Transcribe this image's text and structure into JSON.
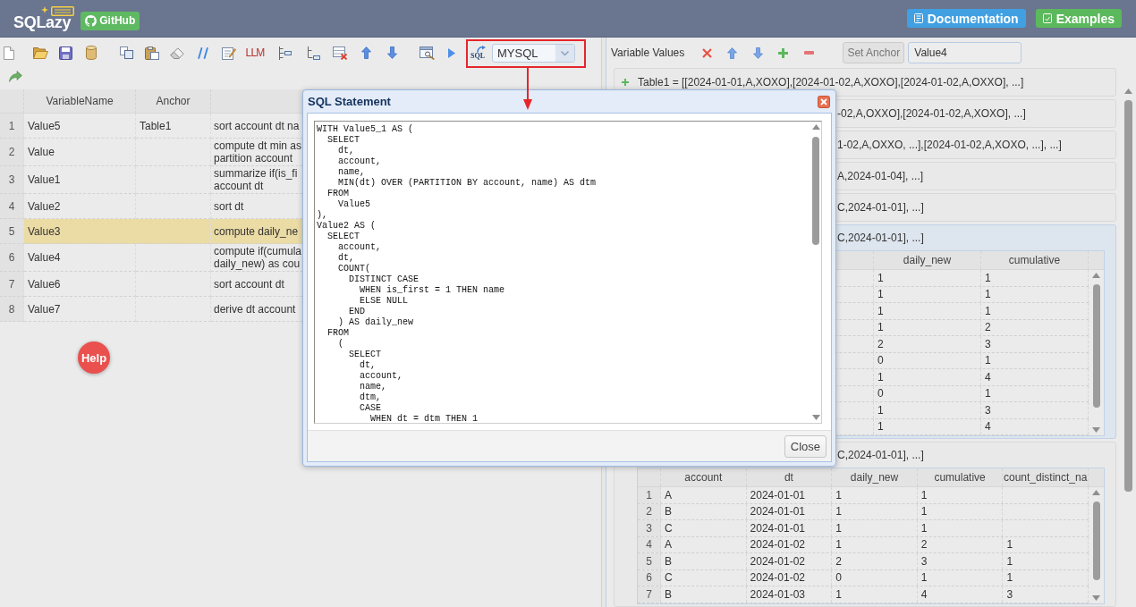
{
  "header": {
    "logo": "SQLazy",
    "badge": "GitHub",
    "links": [
      {
        "kind": "documentation",
        "label": "Documentation",
        "color": "#41a0e2"
      },
      {
        "kind": "examples",
        "label": "Examples",
        "color": "#5cb85c"
      }
    ]
  },
  "toolbar": {
    "llm_button": "LLM",
    "sql_button": "SQL",
    "dialect_select": {
      "value": "MYSQL"
    }
  },
  "variables_table": {
    "columns": [
      "VariableName",
      "Anchor"
    ],
    "rows": [
      {
        "number": "1",
        "name": "Value5",
        "anchor": "Table1",
        "column_3": "sort account dt na",
        "selected": false
      },
      {
        "number": "2",
        "name": "Value",
        "column_3": "compute dt min as\npartition account",
        "selected": false
      },
      {
        "number": "3",
        "name": "Value1",
        "column_3": "summarize if(is_fi\naccount dt",
        "selected": false
      },
      {
        "number": "4",
        "name": "Value2",
        "column_3": "sort dt",
        "selected": false
      },
      {
        "number": "5",
        "name": "Value3",
        "column_3": "compute daily_ne",
        "selected": true
      },
      {
        "number": "6",
        "name": "Value4",
        "column_3": "compute if(cumula\ndaily_new) as cou",
        "selected": false
      },
      {
        "number": "7",
        "name": "Value6",
        "column_3": "sort account dt",
        "selected": false
      },
      {
        "number": "8",
        "name": "Value7",
        "column_3": "derive dt account",
        "selected": false
      }
    ]
  },
  "help_button": "Help",
  "variable_values": {
    "title": "Variable Values",
    "set_anchor_button": "Set Anchor",
    "anchor_field": {
      "value": "Value4"
    },
    "items": [
      {
        "text": "Table1 = [[2024-01-01,A,XOXO],[2024-01-02,A,XOXO],[2024-01-02,A,OXXO], ...]",
        "expanded": false,
        "selected": false
      },
      {
        "text": "-02,A,OXXO],[2024-01-02,A,XOXO], ...]",
        "expanded": false,
        "selected": false
      },
      {
        "text": "1-02,A,OXXO, ...],[2024-01-02,A,XOXO, ...], ...]",
        "expanded": false,
        "selected": false
      },
      {
        "text": "A,2024-01-04], ...]",
        "expanded": false,
        "selected": false
      },
      {
        "text": "C,2024-01-01], ...]",
        "expanded": false,
        "selected": false
      },
      {
        "text": "C,2024-01-01], ...]",
        "expanded": true,
        "selected": true,
        "table": {
          "columns": [
            "daily_new",
            "cumulative"
          ],
          "rows": [
            {
              "cells": [
                "1",
                "1"
              ]
            },
            {
              "cells": [
                "1",
                "1"
              ]
            },
            {
              "cells": [
                "1",
                "1"
              ]
            },
            {
              "cells": [
                "1",
                "2"
              ]
            },
            {
              "cells": [
                "2",
                "3"
              ]
            },
            {
              "cells": [
                "0",
                "1"
              ]
            },
            {
              "cells": [
                "1",
                "4"
              ]
            },
            {
              "cells": [
                "0",
                "1"
              ]
            },
            {
              "cells": [
                "1",
                "3"
              ]
            },
            {
              "cells": [
                "1",
                "4"
              ]
            }
          ]
        }
      },
      {
        "text": "C,2024-01-01], ...]",
        "expanded": true,
        "selected": false,
        "table": {
          "columns": [
            "account",
            "dt",
            "daily_new",
            "cumulative",
            "count_distinct_na"
          ],
          "rows": [
            {
              "number": "1",
              "cells": [
                "A",
                "2024-01-01",
                "1",
                "1"
              ]
            },
            {
              "number": "2",
              "cells": [
                "B",
                "2024-01-01",
                "1",
                "1"
              ]
            },
            {
              "number": "3",
              "cells": [
                "C",
                "2024-01-01",
                "1",
                "1"
              ]
            },
            {
              "number": "4",
              "cells": [
                "A",
                "2024-01-02",
                "1",
                "2",
                "1"
              ]
            },
            {
              "number": "5",
              "cells": [
                "B",
                "2024-01-02",
                "2",
                "3",
                "1"
              ]
            },
            {
              "number": "6",
              "cells": [
                "C",
                "2024-01-02",
                "0",
                "1",
                "1"
              ]
            },
            {
              "number": "7",
              "cells": [
                "B",
                "2024-01-03",
                "1",
                "4",
                "3"
              ]
            }
          ]
        }
      }
    ]
  },
  "dialog": {
    "title": "SQL Statement",
    "sql": "WITH Value5_1 AS (\n  SELECT\n    dt,\n    account,\n    name,\n    MIN(dt) OVER (PARTITION BY account, name) AS dtm\n  FROM\n    Value5\n),\nValue2 AS (\n  SELECT\n    account,\n    dt,\n    COUNT(\n      DISTINCT CASE\n        WHEN is_first = 1 THEN name\n        ELSE NULL\n      END\n    ) AS daily_new\n  FROM\n    (\n      SELECT\n        dt,\n        account,\n        name,\n        dtm,\n        CASE\n          WHEN dt = dtm THEN 1",
    "close_button": "Close"
  }
}
